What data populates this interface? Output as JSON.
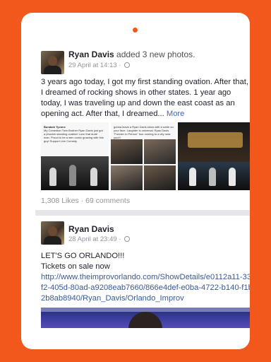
{
  "post1": {
    "author": "Ryan Davis",
    "action": " added 3 new photos.",
    "date": "29 April at 14:13 ·",
    "text": "3 years ago today, I got my first standing ovation. After that, I dreamed of rocking shows in other states. 1 year ago today, I was traveling up and down the east coast as an opening act. After that, I dreamed...",
    "more": " More",
    "photo1_caption_name": "Bundam Tyvone",
    "photo1_caption": "My Comedian Twin Brother Ryan Davis just got a phuckin standing ovation! Love that dude man. Proud to be a wen comic growing with this guy! Support Live Comedy",
    "photo2_caption": "gonna leave a Ryan Davis show with a smile on your face. Laughter is universal. Ryan Davis \"Funnier In Person\" tour coming to a city near you!!!",
    "likes": "1,308 Likes",
    "comments": "69 comments"
  },
  "post2": {
    "author": "Ryan Davis",
    "date": "28 April at 23:49 ·",
    "line1": "LET'S GO ORLANDO!!!",
    "line2": "Tickets on sale now",
    "url": "http://www.theimprovorlando.com/ShowDetails/e0112a11-33f2-405d-80ad-a9208eab7660/866e4def-e0ba-4722-b140-f1b2b8ab8940/Ryan_Davis/Orlando_Improv"
  },
  "colors": {
    "background": "#f2581c",
    "link": "#365899",
    "divider": "#e4e6ea"
  }
}
